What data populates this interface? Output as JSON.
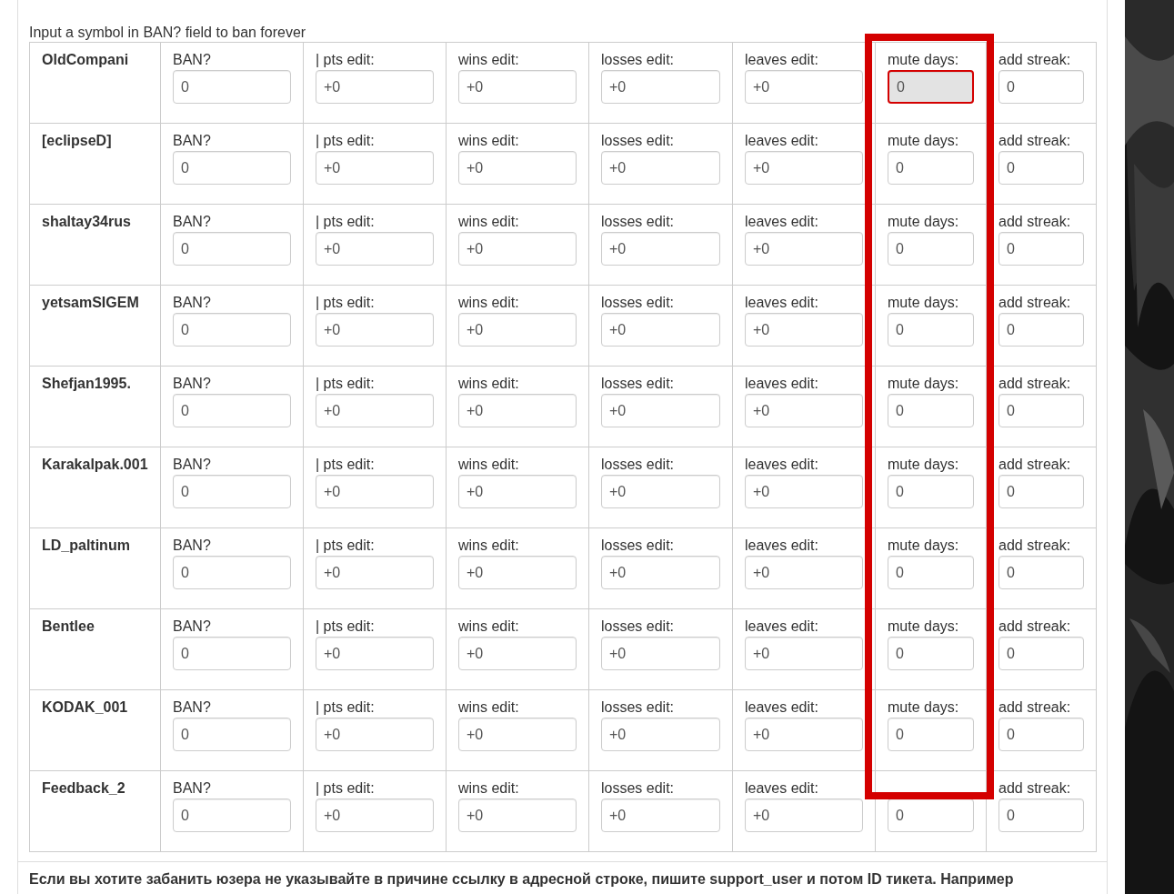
{
  "instruction": "Input a symbol in BAN? field to ban forever",
  "rows": [
    {
      "name": "OldCompani",
      "fields": [
        {
          "label": "BAN?",
          "value": "0"
        },
        {
          "label": "| pts edit:",
          "value": "+0"
        },
        {
          "label": "wins edit:",
          "value": "+0"
        },
        {
          "label": "losses edit:",
          "value": "+0"
        },
        {
          "label": "leaves edit:",
          "value": "+0"
        },
        {
          "label": "mute days:",
          "value": "0",
          "disabled": true
        },
        {
          "label": "add streak:",
          "value": "0"
        }
      ]
    },
    {
      "name": "[eclipseD]",
      "fields": [
        {
          "label": "BAN?",
          "value": "0"
        },
        {
          "label": "| pts edit:",
          "value": "+0"
        },
        {
          "label": "wins edit:",
          "value": "+0"
        },
        {
          "label": "losses edit:",
          "value": "+0"
        },
        {
          "label": "leaves edit:",
          "value": "+0"
        },
        {
          "label": "mute days:",
          "value": "0",
          "disabled": false
        },
        {
          "label": "add streak:",
          "value": "0"
        }
      ]
    },
    {
      "name": "shaltay34rus",
      "fields": [
        {
          "label": "BAN?",
          "value": "0"
        },
        {
          "label": "| pts edit:",
          "value": "+0"
        },
        {
          "label": "wins edit:",
          "value": "+0"
        },
        {
          "label": "losses edit:",
          "value": "+0"
        },
        {
          "label": "leaves edit:",
          "value": "+0"
        },
        {
          "label": "mute days:",
          "value": "0",
          "disabled": false
        },
        {
          "label": "add streak:",
          "value": "0"
        }
      ]
    },
    {
      "name": "yetsamSIGEM",
      "fields": [
        {
          "label": "BAN?",
          "value": "0"
        },
        {
          "label": "| pts edit:",
          "value": "+0"
        },
        {
          "label": "wins edit:",
          "value": "+0"
        },
        {
          "label": "losses edit:",
          "value": "+0"
        },
        {
          "label": "leaves edit:",
          "value": "+0"
        },
        {
          "label": "mute days:",
          "value": "0",
          "disabled": false
        },
        {
          "label": "add streak:",
          "value": "0"
        }
      ]
    },
    {
      "name": "Shefjan1995.",
      "fields": [
        {
          "label": "BAN?",
          "value": "0"
        },
        {
          "label": "| pts edit:",
          "value": "+0"
        },
        {
          "label": "wins edit:",
          "value": "+0"
        },
        {
          "label": "losses edit:",
          "value": "+0"
        },
        {
          "label": "leaves edit:",
          "value": "+0"
        },
        {
          "label": "mute days:",
          "value": "0",
          "disabled": false
        },
        {
          "label": "add streak:",
          "value": "0"
        }
      ]
    },
    {
      "name": "Karakalpak.001",
      "fields": [
        {
          "label": "BAN?",
          "value": "0"
        },
        {
          "label": "| pts edit:",
          "value": "+0"
        },
        {
          "label": "wins edit:",
          "value": "+0"
        },
        {
          "label": "losses edit:",
          "value": "+0"
        },
        {
          "label": "leaves edit:",
          "value": "+0"
        },
        {
          "label": "mute days:",
          "value": "0",
          "disabled": false
        },
        {
          "label": "add streak:",
          "value": "0"
        }
      ]
    },
    {
      "name": "LD_paltinum",
      "fields": [
        {
          "label": "BAN?",
          "value": "0"
        },
        {
          "label": "| pts edit:",
          "value": "+0"
        },
        {
          "label": "wins edit:",
          "value": "+0"
        },
        {
          "label": "losses edit:",
          "value": "+0"
        },
        {
          "label": "leaves edit:",
          "value": "+0"
        },
        {
          "label": "mute days:",
          "value": "0",
          "disabled": false
        },
        {
          "label": "add streak:",
          "value": "0"
        }
      ]
    },
    {
      "name": "Bentlee",
      "fields": [
        {
          "label": "BAN?",
          "value": "0"
        },
        {
          "label": "| pts edit:",
          "value": "+0"
        },
        {
          "label": "wins edit:",
          "value": "+0"
        },
        {
          "label": "losses edit:",
          "value": "+0"
        },
        {
          "label": "leaves edit:",
          "value": "+0"
        },
        {
          "label": "mute days:",
          "value": "0",
          "disabled": false
        },
        {
          "label": "add streak:",
          "value": "0"
        }
      ]
    },
    {
      "name": "KODAK_001",
      "fields": [
        {
          "label": "BAN?",
          "value": "0"
        },
        {
          "label": "| pts edit:",
          "value": "+0"
        },
        {
          "label": "wins edit:",
          "value": "+0"
        },
        {
          "label": "losses edit:",
          "value": "+0"
        },
        {
          "label": "leaves edit:",
          "value": "+0"
        },
        {
          "label": "mute days:",
          "value": "0",
          "disabled": false
        },
        {
          "label": "add streak:",
          "value": "0"
        }
      ]
    },
    {
      "name": "Feedback_2",
      "fields": [
        {
          "label": "BAN?",
          "value": "0"
        },
        {
          "label": "| pts edit:",
          "value": "+0"
        },
        {
          "label": "wins edit:",
          "value": "+0"
        },
        {
          "label": "losses edit:",
          "value": "+0"
        },
        {
          "label": "leaves edit:",
          "value": "+0"
        },
        {
          "value": "0",
          "disabled": false
        },
        {
          "label": "add streak:",
          "value": "0"
        }
      ]
    }
  ],
  "note": "Если вы хотите забанить юзера не указывайте в причине ссылку в адресной строке, пишите support_user и потом ID тикета. Например"
}
